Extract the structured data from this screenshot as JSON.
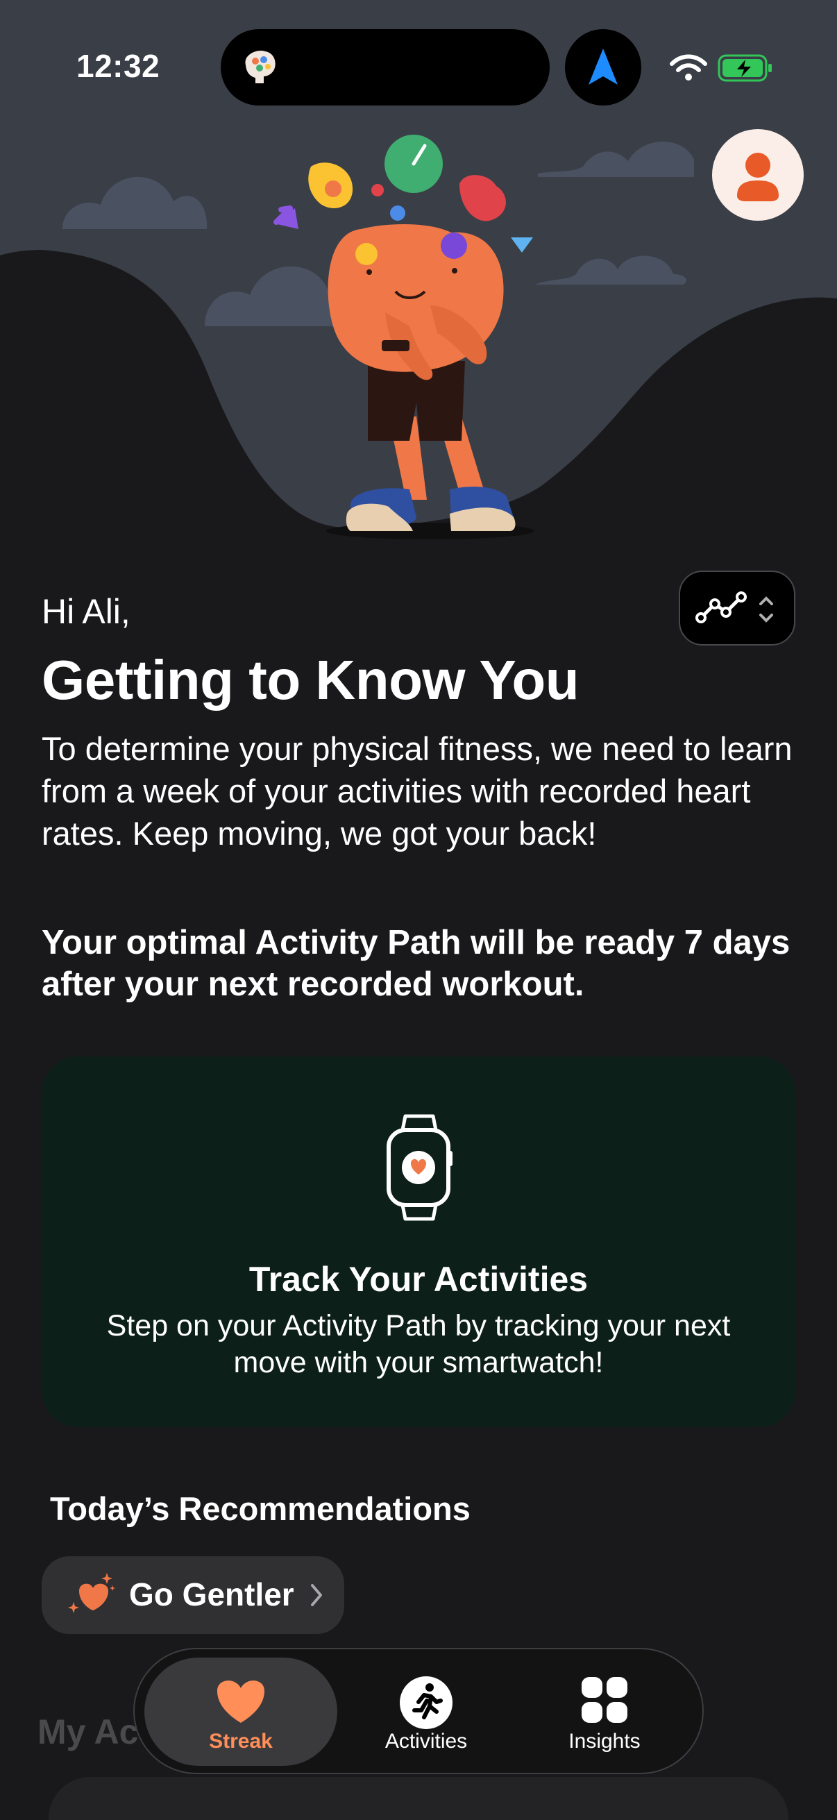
{
  "status_bar": {
    "time": "12:32"
  },
  "greeting": "Hi Ali,",
  "title": "Getting to Know You",
  "intro_text": "To determine your physical fitness, we need to learn from a week of your activities with recorded heart rates. Keep moving, we got your back!",
  "emphasis_text": "Your optimal Activity Path will be ready 7 days after your next recorded workout.",
  "track_card": {
    "title": "Track Your Activities",
    "body": "Step on your Activity Path by tracking your next move with your smartwatch!"
  },
  "recommendations": {
    "title": "Today’s Recommendations",
    "items": [
      {
        "label": "Go Gentler",
        "icon": "heart-sparkle-icon"
      }
    ]
  },
  "my_activities_title": "My Ac",
  "tab_bar": {
    "tabs": [
      {
        "label": "Streak",
        "icon": "heart-icon",
        "active": true
      },
      {
        "label": "Activities",
        "icon": "runner-icon",
        "active": false
      },
      {
        "label": "Insights",
        "icon": "grid-icon",
        "active": false
      }
    ]
  },
  "colors": {
    "background": "#19191b",
    "accent_orange": "#ff8e58",
    "card_green": "#0c1f18",
    "pill_gray": "#303033"
  }
}
